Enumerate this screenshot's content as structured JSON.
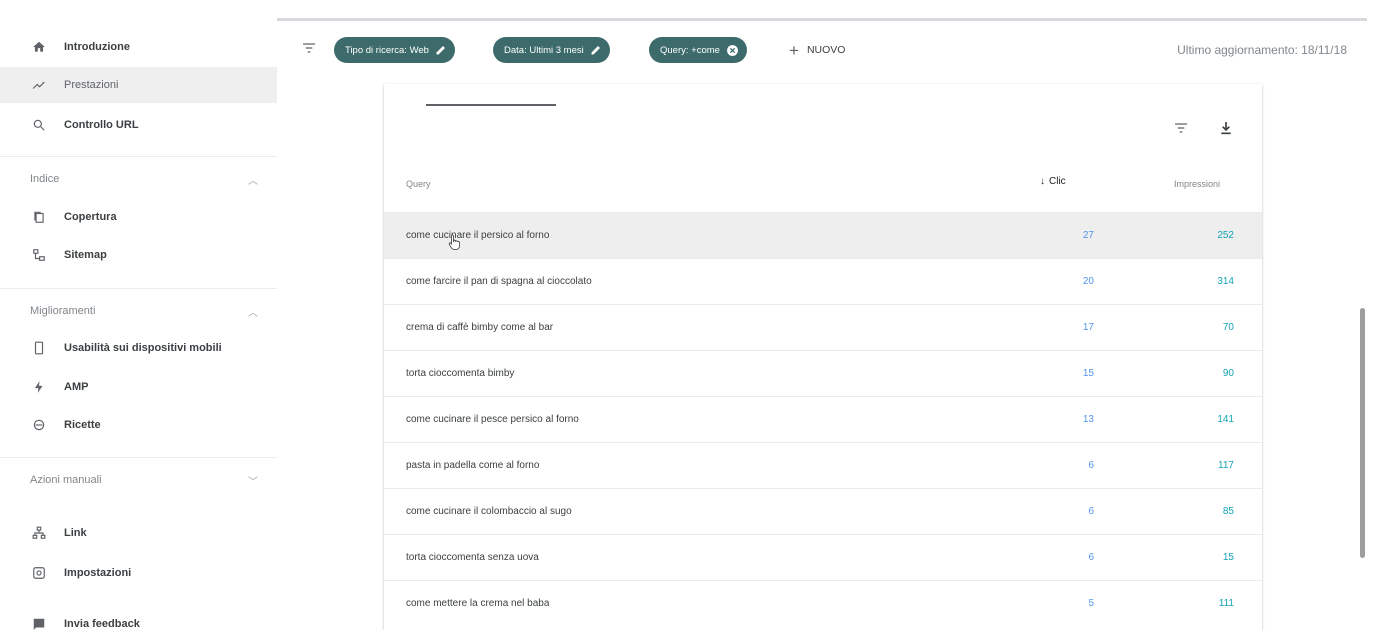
{
  "sidebar": {
    "items": [
      {
        "label": "Introduzione",
        "icon": "home-icon"
      },
      {
        "label": "Prestazioni",
        "icon": "trending-up-icon"
      },
      {
        "label": "Controllo URL",
        "icon": "search-icon"
      }
    ],
    "sections": [
      {
        "title": "Indice",
        "chevron": "up",
        "items": [
          {
            "label": "Copertura",
            "icon": "copy-icon"
          },
          {
            "label": "Sitemap",
            "icon": "sitemap-icon"
          }
        ]
      },
      {
        "title": "Miglioramenti",
        "chevron": "up",
        "items": [
          {
            "label": "Usabilità sui dispositivi mobili",
            "icon": "phone-icon"
          },
          {
            "label": "AMP",
            "icon": "bolt-icon"
          },
          {
            "label": "Ricette",
            "icon": "recipe-icon"
          }
        ]
      },
      {
        "title": "Azioni manuali",
        "chevron": "down",
        "items": []
      }
    ],
    "bottom": [
      {
        "label": "Link",
        "icon": "link-tree-icon"
      },
      {
        "label": "Impostazioni",
        "icon": "gear-icon"
      },
      {
        "label": "Invia feedback",
        "icon": "feedback-icon"
      }
    ]
  },
  "toolbar": {
    "chips": [
      {
        "label": "Tipo di ricerca: Web",
        "icon": "pencil-icon"
      },
      {
        "label": "Data: Ultimi 3 mesi",
        "icon": "pencil-icon"
      },
      {
        "label": "Query: +come",
        "icon": "close-circle-icon"
      }
    ],
    "new_label": "NUOVO",
    "updated": "Ultimo aggiornamento: 18/11/18"
  },
  "table": {
    "col_query": "Query",
    "col_clicks": "Clic",
    "col_impressions": "Impressioni",
    "rows": [
      {
        "query": "come cucinare il persico al forno",
        "clicks": "27",
        "impressions": "252"
      },
      {
        "query": "come farcire il pan di spagna al cioccolato",
        "clicks": "20",
        "impressions": "314"
      },
      {
        "query": "crema di caffè bimby come al bar",
        "clicks": "17",
        "impressions": "70"
      },
      {
        "query": "torta cioccomenta bimby",
        "clicks": "15",
        "impressions": "90"
      },
      {
        "query": "come cucinare il pesce persico al forno",
        "clicks": "13",
        "impressions": "141"
      },
      {
        "query": "pasta in padella come al forno",
        "clicks": "6",
        "impressions": "117"
      },
      {
        "query": "come cucinare il colombaccio al sugo",
        "clicks": "6",
        "impressions": "85"
      },
      {
        "query": "torta cioccomenta senza uova",
        "clicks": "6",
        "impressions": "15"
      },
      {
        "query": "come mettere la crema nel baba",
        "clicks": "5",
        "impressions": "111"
      }
    ]
  },
  "colors": {
    "chip": "#3d6b6b",
    "clicks": "#1a73e8",
    "impressions": "#12a4b5"
  }
}
